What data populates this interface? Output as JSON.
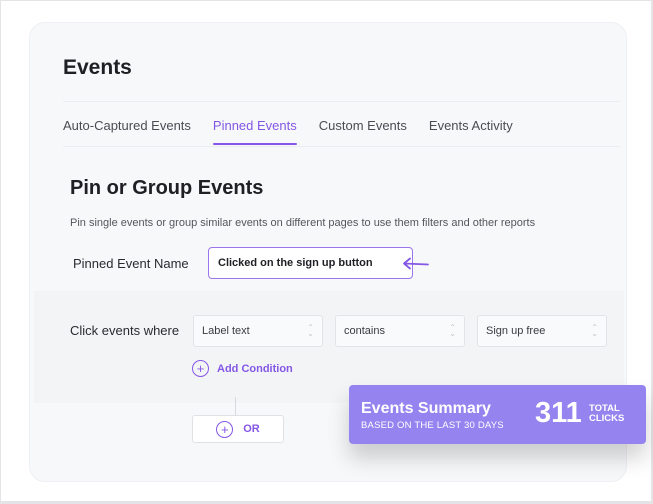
{
  "page": {
    "title": "Events"
  },
  "tabs": [
    {
      "label": "Auto-Captured Events",
      "active": false
    },
    {
      "label": "Pinned Events",
      "active": true
    },
    {
      "label": "Custom Events",
      "active": false
    },
    {
      "label": "Events Activity",
      "active": false
    }
  ],
  "section": {
    "title": "Pin or Group Events",
    "description": "Pin single events or group similar events on different pages to use them filters and other reports"
  },
  "pinned_event": {
    "label": "Pinned Event Name",
    "value": "Clicked on the sign up button",
    "pointer_icon": "arrow-left-icon"
  },
  "conditions": {
    "label": "Click events where",
    "selects": [
      {
        "value": "Label text"
      },
      {
        "value": "contains"
      },
      {
        "value": "Sign up free"
      }
    ],
    "add_condition_label": "Add Condition",
    "or_label": "OR"
  },
  "summary": {
    "title": "Events Summary",
    "subtitle": "BASED ON THE LAST 30 DAYS",
    "count": "311",
    "unit_line1": "TOTAL",
    "unit_line2": "CLICKS"
  },
  "colors": {
    "accent": "#8457e6",
    "summary_bg": "#9584ef",
    "card_bg": "#f7f8fa"
  }
}
